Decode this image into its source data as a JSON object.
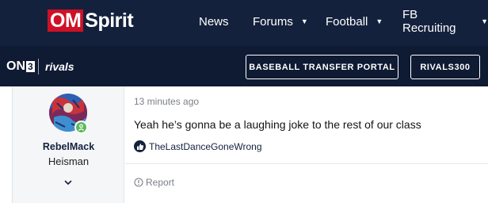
{
  "header": {
    "logo_part1": "OM",
    "logo_part2": "Spirit",
    "nav": [
      {
        "label": "News"
      },
      {
        "label": "Forums"
      },
      {
        "label": "Football"
      },
      {
        "label": "FB Recruiting"
      }
    ]
  },
  "subbar": {
    "brand_on": "ON",
    "brand_3": "3",
    "brand_rivals": "rivals",
    "buttons": [
      {
        "label": "BASEBALL TRANSFER PORTAL"
      },
      {
        "label": "RIVALS300"
      }
    ]
  },
  "post": {
    "author": "RebelMack",
    "author_title": "Heisman",
    "time": "13 minutes ago",
    "message": "Yeah he’s gonna be a laughing joke to the rest of our class",
    "reaction_user": "TheLastDanceGoneWrong",
    "report_label": "Report"
  },
  "colors": {
    "nav_bg": "#14213d",
    "subbar_bg": "#0f1a33",
    "brand_red": "#ce1126",
    "online_green": "#5cb85c"
  },
  "icons": [
    "chevron-down-icon",
    "online-status-icon",
    "like-icon",
    "report-icon"
  ]
}
